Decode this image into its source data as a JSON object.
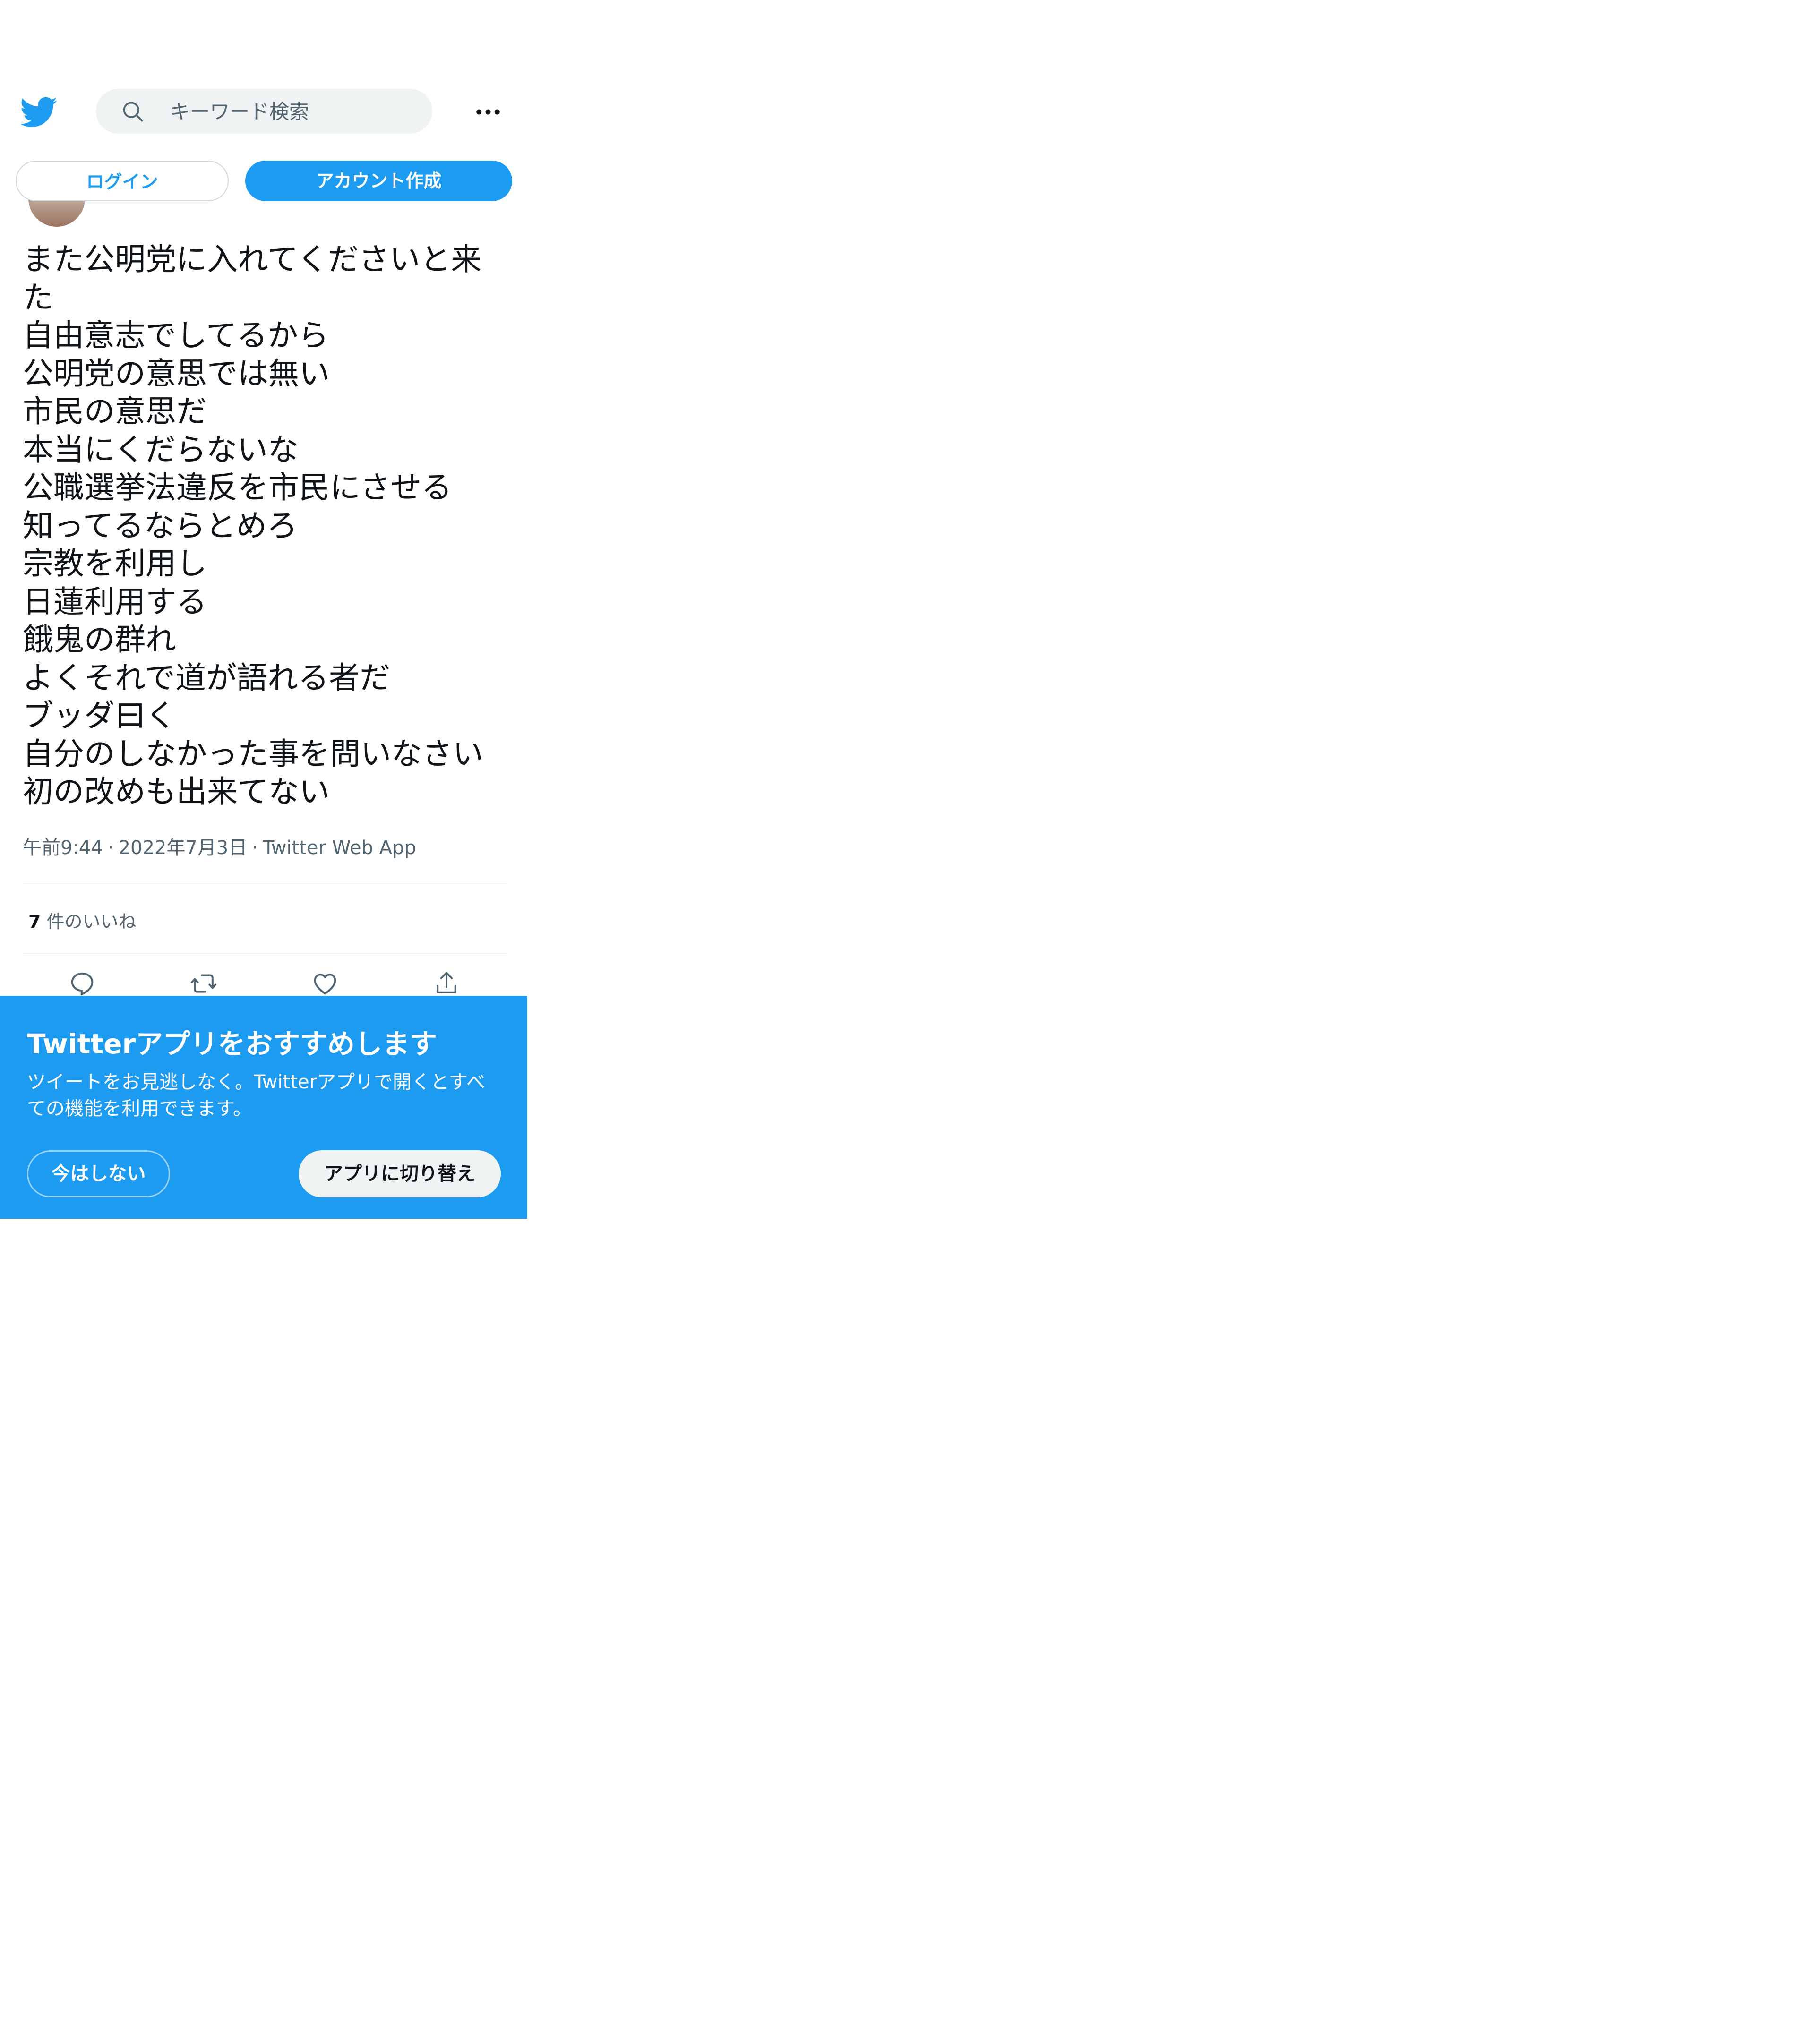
{
  "colors": {
    "brand": "#1d9bf0",
    "text": "#0f1419",
    "muted": "#536471"
  },
  "search": {
    "placeholder": "キーワード検索"
  },
  "auth": {
    "login_label": "ログイン",
    "signup_label": "アカウント作成"
  },
  "tweet": {
    "lines": [
      "また公明党に入れてくださいと来",
      "た",
      "自由意志でしてるから",
      "公明党の意思では無い",
      "市民の意思だ",
      "本当にくだらないな",
      "公職選挙法違反を市民にさせる",
      "知ってるならとめろ",
      "宗教を利用し",
      "日蓮利用する",
      "餓鬼の群れ",
      "よくそれで道が語れる者だ",
      "ブッダ曰く",
      "自分のしなかった事を問いなさい",
      "初の改めも出来てない"
    ],
    "time": "午前9:44",
    "date": "2022年7月3日",
    "source": "Twitter Web App",
    "separator": "·",
    "like_count": "7",
    "like_label": "件のいいね"
  },
  "promo": {
    "title": "Twitterアプリをおすすめします",
    "body_line1": "ツイートをお見逃しなく。Twitterアプリで開くとすべ",
    "body_line2": "ての機能を利用できます。",
    "not_now_label": "今はしない",
    "switch_label": "アプリに切り替え"
  }
}
